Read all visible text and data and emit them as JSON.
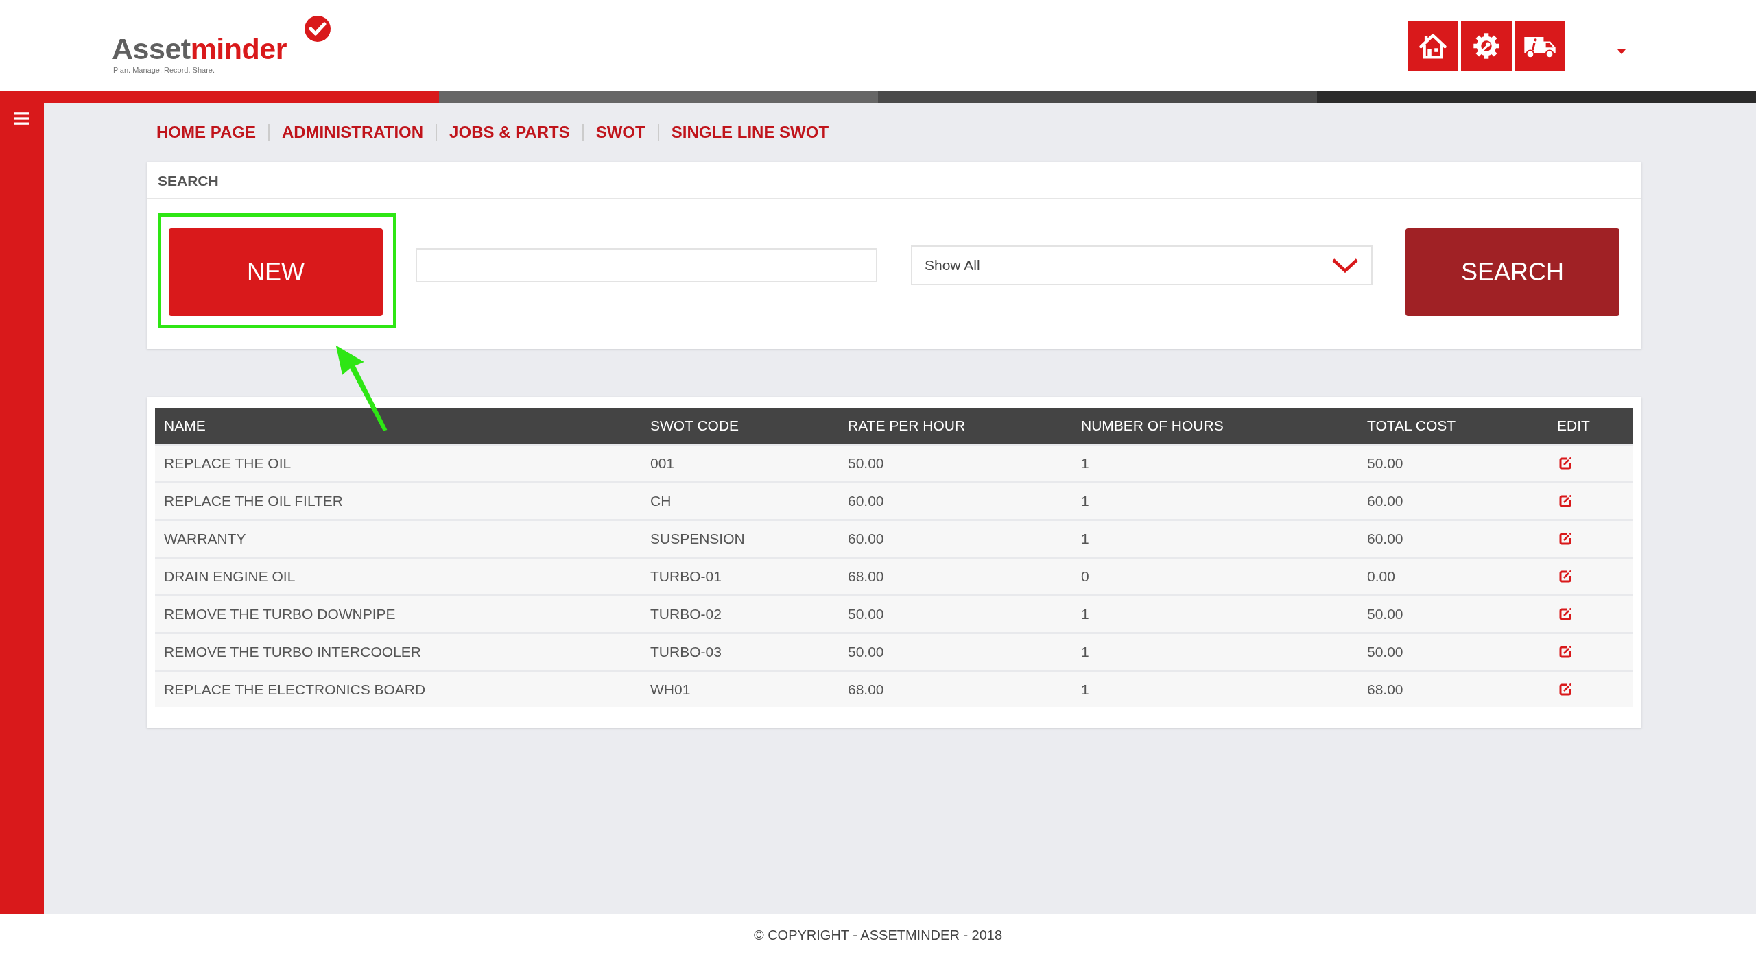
{
  "logo": {
    "prefix": "Asset",
    "suffix": "minder",
    "tagline": "Plan. Manage. Record. Share."
  },
  "nav": [
    {
      "label": "HOME PAGE"
    },
    {
      "label": "ADMINISTRATION"
    },
    {
      "label": "JOBS & PARTS"
    },
    {
      "label": "SWOT"
    },
    {
      "label": "SINGLE LINE SWOT"
    }
  ],
  "search_panel": {
    "title": "SEARCH",
    "new_button": "NEW",
    "filter": {
      "value": "Show All"
    },
    "search_button": "SEARCH"
  },
  "table": {
    "columns": [
      "NAME",
      "SWOT CODE",
      "RATE PER HOUR",
      "NUMBER OF HOURS",
      "TOTAL COST",
      "EDIT"
    ],
    "rows": [
      {
        "name": "REPLACE THE OIL",
        "swot_code": "001",
        "rate_per_hour": "50.00",
        "number_of_hours": "1",
        "total_cost": "50.00"
      },
      {
        "name": "REPLACE THE OIL FILTER",
        "swot_code": "CH",
        "rate_per_hour": "60.00",
        "number_of_hours": "1",
        "total_cost": "60.00"
      },
      {
        "name": "WARRANTY",
        "swot_code": "SUSPENSION",
        "rate_per_hour": "60.00",
        "number_of_hours": "1",
        "total_cost": "60.00"
      },
      {
        "name": "DRAIN ENGINE OIL",
        "swot_code": "TURBO-01",
        "rate_per_hour": "68.00",
        "number_of_hours": "0",
        "total_cost": "0.00"
      },
      {
        "name": "REMOVE THE TURBO DOWNPIPE",
        "swot_code": "TURBO-02",
        "rate_per_hour": "50.00",
        "number_of_hours": "1",
        "total_cost": "50.00"
      },
      {
        "name": "REMOVE THE TURBO INTERCOOLER",
        "swot_code": "TURBO-03",
        "rate_per_hour": "50.00",
        "number_of_hours": "1",
        "total_cost": "50.00"
      },
      {
        "name": "REPLACE THE ELECTRONICS BOARD",
        "swot_code": "WH01",
        "rate_per_hour": "68.00",
        "number_of_hours": "1",
        "total_cost": "68.00"
      }
    ]
  },
  "footer": "© COPYRIGHT - ASSETMINDER - 2018"
}
